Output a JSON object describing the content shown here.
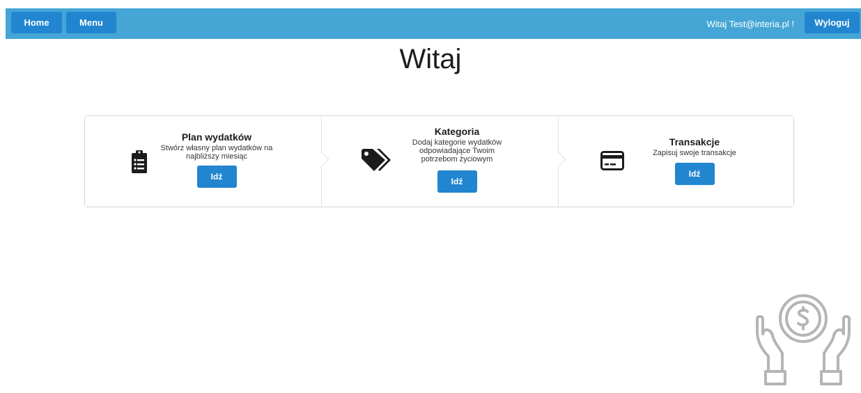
{
  "navbar": {
    "home_label": "Home",
    "menu_label": "Menu",
    "greeting": "Witaj Test@interia.pl !",
    "logout_label": "Wyloguj"
  },
  "page": {
    "title": "Witaj"
  },
  "steps": [
    {
      "title": "Plan wydatków",
      "description_lines": [
        "Stwórz własny plan wydatków na",
        "najbliższy miesiąc"
      ],
      "button_label": "Idź",
      "icon": "clipboard-list-icon"
    },
    {
      "title": "Kategoria",
      "description_lines": [
        "Dodaj kategorie wydatków",
        "odpowiadające Twoim",
        "potrzebom życiowym"
      ],
      "button_label": "Idź",
      "icon": "tags-icon"
    },
    {
      "title": "Transakcje",
      "description_lines": [
        "Zapisuj swoje transakcje"
      ],
      "button_label": "Idź",
      "icon": "credit-card-icon"
    }
  ],
  "decoration": {
    "icon": "hands-holding-coin-icon"
  },
  "colors": {
    "navbar_bg": "#45a6d6",
    "button_blue": "#2185d0",
    "decor_gray": "#b5b5b5"
  }
}
